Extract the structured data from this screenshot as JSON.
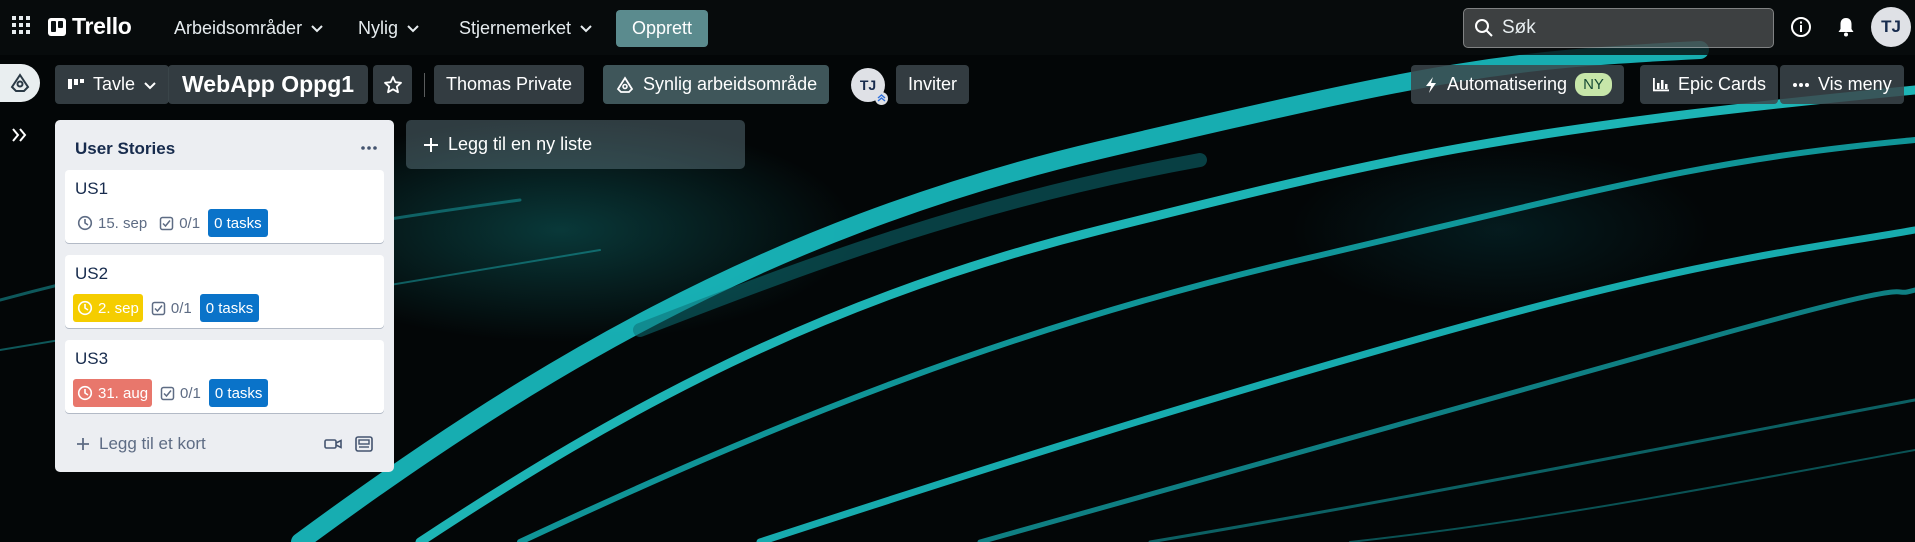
{
  "topbar": {
    "app_name": "Trello",
    "nav": [
      {
        "label": "Arbeidsområder"
      },
      {
        "label": "Nylig"
      },
      {
        "label": "Stjernemerket"
      }
    ],
    "create_label": "Opprett",
    "search_placeholder": "Søk",
    "user_initials": "TJ"
  },
  "board": {
    "view_label": "Tavle",
    "title": "WebApp Oppg1",
    "workspace_label": "Thomas Private",
    "visibility_label": "Synlig arbeidsområde",
    "member_initials": "TJ",
    "invite_label": "Inviter",
    "automation_label": "Automatisering",
    "automation_badge": "NY",
    "epic_cards_label": "Epic Cards",
    "menu_label": "Vis meny"
  },
  "list": {
    "title": "User Stories",
    "cards": [
      {
        "title": "US1",
        "due": "15. sep",
        "checklist": "0/1",
        "tasks": "0 tasks",
        "due_status": "normal"
      },
      {
        "title": "US2",
        "due": "2. sep",
        "checklist": "0/1",
        "tasks": "0 tasks",
        "due_status": "due-soon"
      },
      {
        "title": "US3",
        "due": "31. aug",
        "checklist": "0/1",
        "tasks": "0 tasks",
        "due_status": "overdue"
      }
    ],
    "add_card_label": "Legg til et kort"
  },
  "add_list_label": "Legg til en ny liste",
  "colors": {
    "accent_create": "#5b8b8e",
    "due_soon": "#f5cd00",
    "overdue": "#e8776c",
    "tasks_badge": "#0a73c9",
    "new_badge": "#c7e6a9"
  }
}
